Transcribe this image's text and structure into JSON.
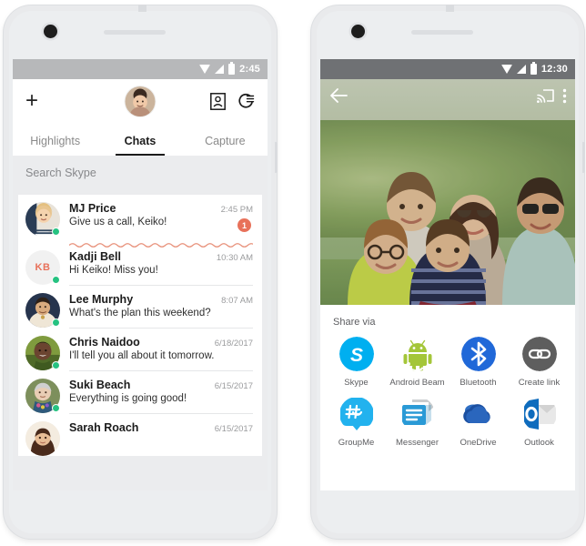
{
  "left_phone": {
    "status_bar": {
      "time": "2:45",
      "icons": [
        "wifi-icon",
        "signal-icon",
        "battery-icon"
      ]
    },
    "header": {
      "add_label": "+",
      "avatar_name": "my-profile-avatar",
      "icon_contacts": "contact-card-icon",
      "icon_calls": "call-history-icon"
    },
    "tabs": [
      {
        "label": "Highlights",
        "active": false
      },
      {
        "label": "Chats",
        "active": true
      },
      {
        "label": "Capture",
        "active": false
      }
    ],
    "search": {
      "placeholder": "Search Skype"
    },
    "chats": [
      {
        "name": "MJ Price",
        "message": "Give us a call, Keiko!",
        "time": "2:45 PM",
        "badge": "1",
        "presence": "online",
        "avatar_type": "photo",
        "initials": ""
      },
      {
        "name": "Kadji Bell",
        "message": "Hi Keiko! Miss you!",
        "time": "10:30 AM",
        "badge": "",
        "presence": "online",
        "avatar_type": "initials",
        "initials": "KB"
      },
      {
        "name": "Lee Murphy",
        "message": "What's the plan this weekend?",
        "time": "8:07 AM",
        "badge": "",
        "presence": "online",
        "avatar_type": "photo",
        "initials": ""
      },
      {
        "name": "Chris Naidoo",
        "message": "I'll tell you all about it tomorrow.",
        "time": "6/18/2017",
        "badge": "",
        "presence": "online",
        "avatar_type": "photo",
        "initials": ""
      },
      {
        "name": "Suki Beach",
        "message": "Everything is going good!",
        "time": "6/15/2017",
        "badge": "",
        "presence": "online",
        "avatar_type": "photo",
        "initials": ""
      },
      {
        "name": "Sarah Roach",
        "message": "",
        "time": "6/15/2017",
        "badge": "",
        "presence": "none",
        "avatar_type": "photo",
        "initials": ""
      }
    ]
  },
  "right_phone": {
    "status_bar": {
      "time": "12:30",
      "icons": [
        "wifi-icon",
        "signal-icon",
        "battery-icon"
      ]
    },
    "photo_nav": {
      "back": "back-arrow-icon",
      "cast": "cast-icon",
      "overflow": "overflow-menu-icon"
    },
    "photo_alt": "family-group-photo-outdoors",
    "share": {
      "title": "Share via",
      "items": [
        {
          "label": "Skype",
          "icon": "skype-icon",
          "color": "#00aff0"
        },
        {
          "label": "Android Beam",
          "icon": "android-beam-icon",
          "color": "#a4c639"
        },
        {
          "label": "Bluetooth",
          "icon": "bluetooth-icon",
          "color": "#2068d8"
        },
        {
          "label": "Create link",
          "icon": "link-icon",
          "color": "#5e5e5e"
        },
        {
          "label": "GroupMe",
          "icon": "groupme-icon",
          "color": "#22b2ee"
        },
        {
          "label": "Messenger",
          "icon": "messenger-icon",
          "color": "#2a9ad6"
        },
        {
          "label": "OneDrive",
          "icon": "onedrive-icon",
          "color": "#1b4fa0"
        },
        {
          "label": "Outlook",
          "icon": "outlook-icon",
          "color": "#0f6cbd"
        }
      ]
    }
  },
  "theme": {
    "accent_coral": "#e8715a",
    "presence_green": "#26c281",
    "status_bar_light": "#b7b8ba",
    "status_bar_dark": "#6f7174",
    "list_bg": "#ebecee",
    "phone_body": "#e9eaec"
  }
}
